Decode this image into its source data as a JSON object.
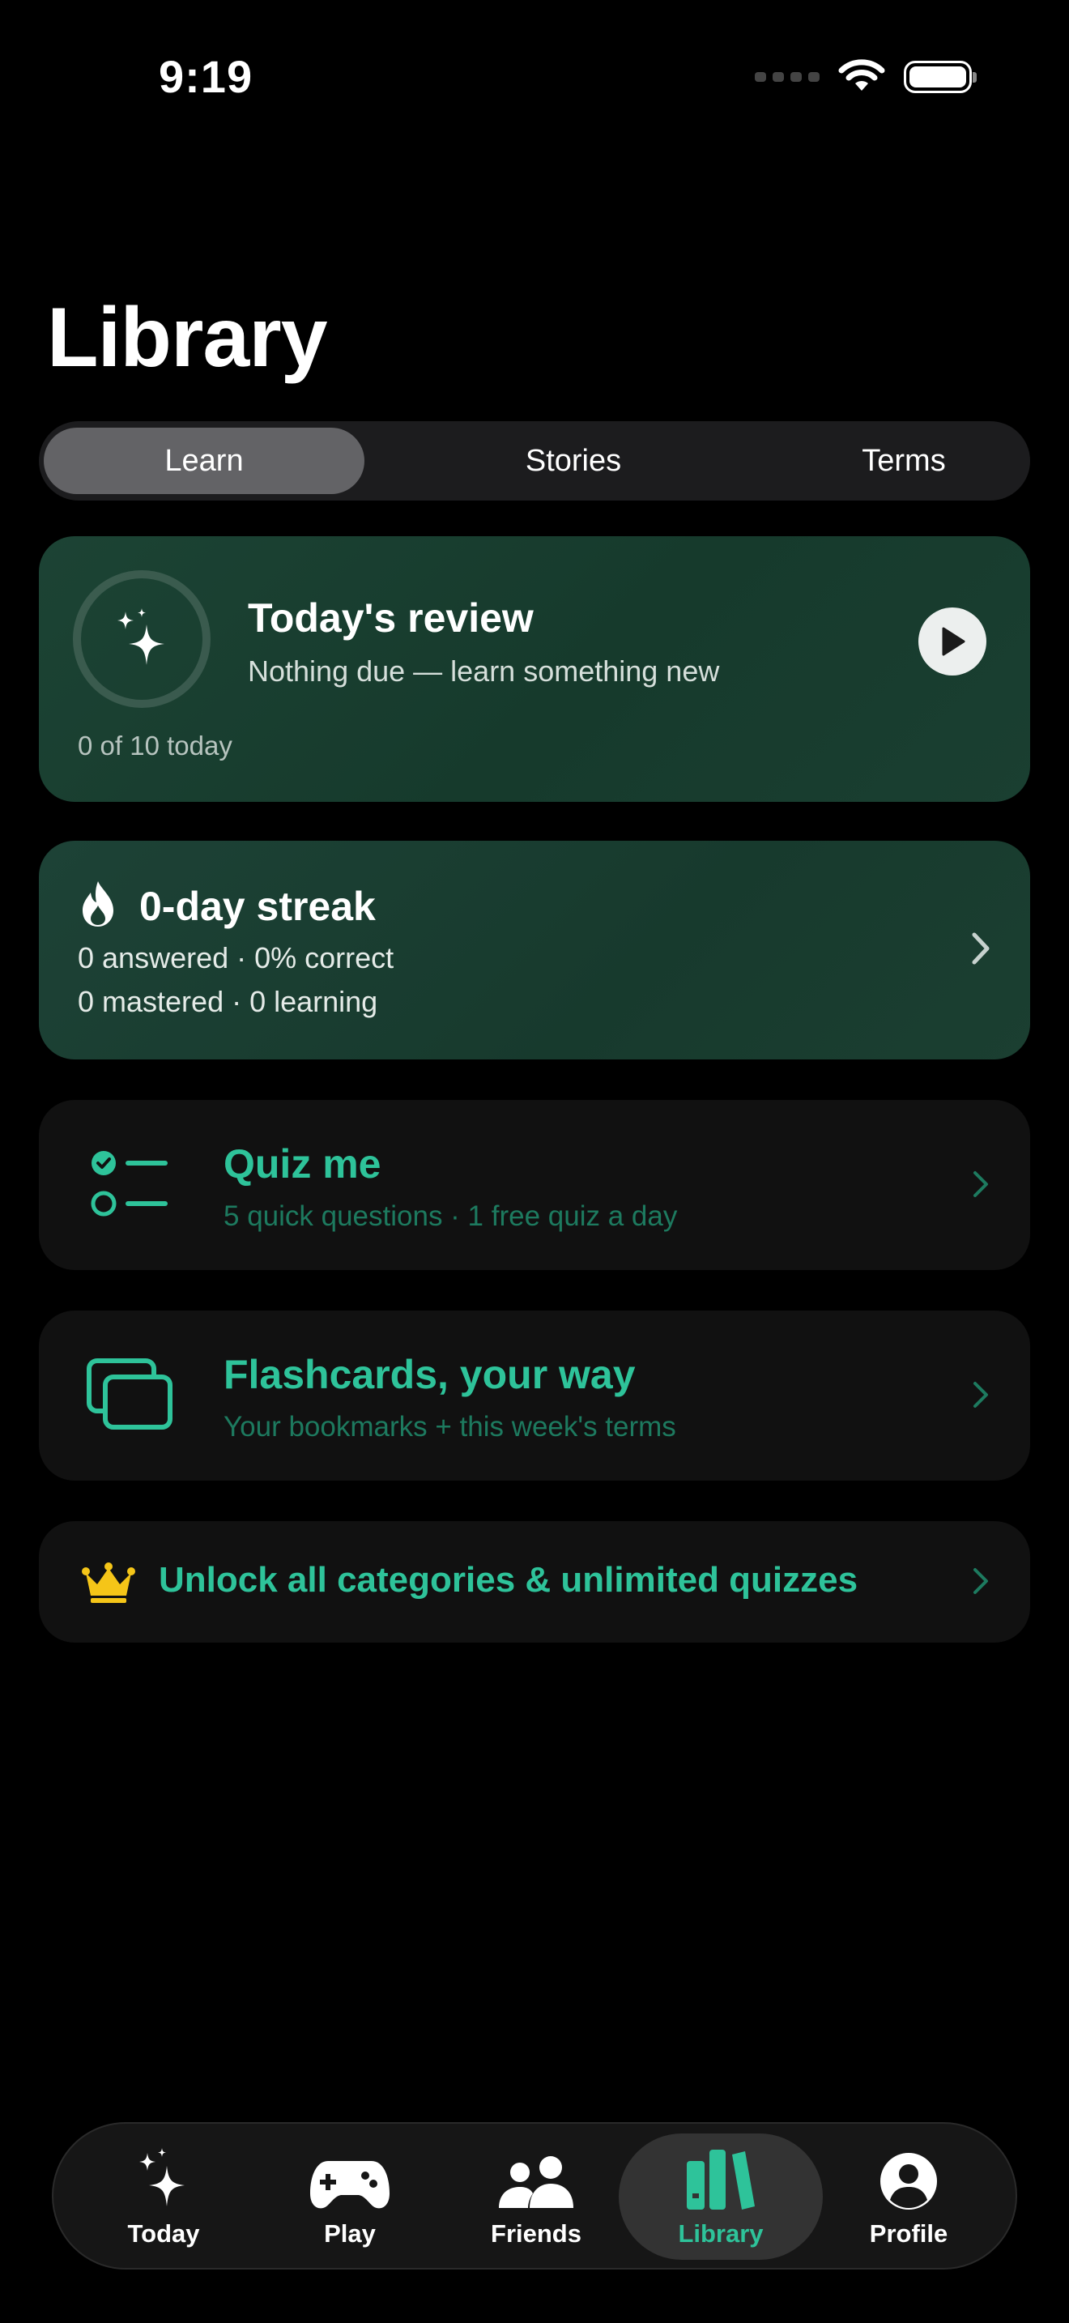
{
  "status_bar": {
    "time": "9:19"
  },
  "page": {
    "title": "Library"
  },
  "segments": [
    {
      "label": "Learn",
      "selected": true
    },
    {
      "label": "Stories",
      "selected": false
    },
    {
      "label": "Terms",
      "selected": false
    }
  ],
  "review": {
    "title": "Today's review",
    "subtitle": "Nothing due — learn something new",
    "count": "0 of 10 today",
    "icon": "sparkles-icon"
  },
  "streak": {
    "title": "0-day streak",
    "line1": "0 answered · 0% correct",
    "line2": "0 mastered · 0 learning",
    "icon": "flame-icon"
  },
  "quiz": {
    "title": "Quiz me",
    "subtitle": "5 quick questions · 1 free quiz a day",
    "icon": "checklist-icon"
  },
  "flashcards": {
    "title": "Flashcards, your way",
    "subtitle": "Your bookmarks + this week's terms",
    "icon": "cards-icon"
  },
  "unlock": {
    "text": "Unlock all categories & unlimited quizzes",
    "icon": "crown-icon"
  },
  "tabbar": {
    "tabs": [
      {
        "label": "Today",
        "icon": "sparkles-icon",
        "selected": false
      },
      {
        "label": "Play",
        "icon": "gamecontroller-icon",
        "selected": false
      },
      {
        "label": "Friends",
        "icon": "people-icon",
        "selected": false
      },
      {
        "label": "Library",
        "icon": "books-icon",
        "selected": true
      },
      {
        "label": "Profile",
        "icon": "person-circle-icon",
        "selected": false
      }
    ]
  },
  "colors": {
    "accent": "#2ec39a",
    "background": "#000000",
    "card_dark": "#111111",
    "card_green": "#1b3f31",
    "crown": "#f5c518"
  }
}
